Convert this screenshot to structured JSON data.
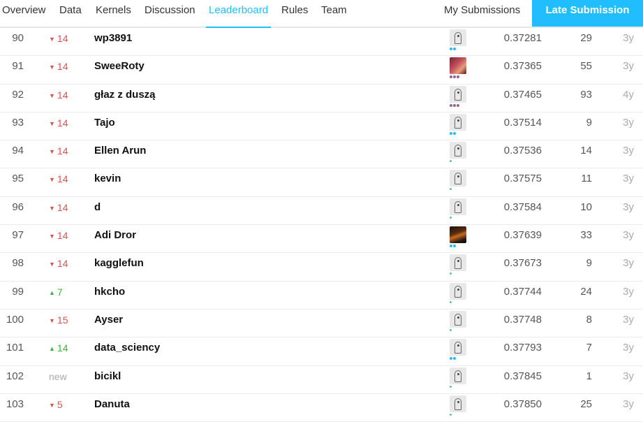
{
  "nav": {
    "tabs": [
      {
        "label": "Overview",
        "name": "tab-overview",
        "active": false
      },
      {
        "label": "Data",
        "name": "tab-data",
        "active": false
      },
      {
        "label": "Kernels",
        "name": "tab-kernels",
        "active": false
      },
      {
        "label": "Discussion",
        "name": "tab-discussion",
        "active": false
      },
      {
        "label": "Leaderboard",
        "name": "tab-leaderboard",
        "active": true
      },
      {
        "label": "Rules",
        "name": "tab-rules",
        "active": false
      },
      {
        "label": "Team",
        "name": "tab-team",
        "active": false
      }
    ],
    "my_submissions": "My Submissions",
    "late_submission": "Late Submission"
  },
  "colors": {
    "accent": "#20beff",
    "down": "#d9534f",
    "up": "#3db33d",
    "tier_contributor": "#20beff",
    "tier_expert": "#95628f",
    "tier_novice": "#5ac995"
  },
  "leaderboard": {
    "rows": [
      {
        "rank": "90",
        "change": "14",
        "direction": "down",
        "team": "wp3891",
        "avatar": "default",
        "tier": "contributor",
        "score": "0.37281",
        "entries": "29",
        "last": "3y"
      },
      {
        "rank": "91",
        "change": "14",
        "direction": "down",
        "team": "SweeRoty",
        "avatar": "photo1",
        "tier": "expert",
        "score": "0.37365",
        "entries": "55",
        "last": "3y"
      },
      {
        "rank": "92",
        "change": "14",
        "direction": "down",
        "team": "głaz z duszą",
        "avatar": "default",
        "tier": "expert",
        "score": "0.37465",
        "entries": "93",
        "last": "4y"
      },
      {
        "rank": "93",
        "change": "14",
        "direction": "down",
        "team": "Tajo",
        "avatar": "default",
        "tier": "contributor",
        "score": "0.37514",
        "entries": "9",
        "last": "3y"
      },
      {
        "rank": "94",
        "change": "14",
        "direction": "down",
        "team": "Ellen Arun",
        "avatar": "default",
        "tier": "novice",
        "score": "0.37536",
        "entries": "14",
        "last": "3y"
      },
      {
        "rank": "95",
        "change": "14",
        "direction": "down",
        "team": "kevin",
        "avatar": "default",
        "tier": "novice",
        "score": "0.37575",
        "entries": "11",
        "last": "3y"
      },
      {
        "rank": "96",
        "change": "14",
        "direction": "down",
        "team": "d",
        "avatar": "default",
        "tier": "novice",
        "score": "0.37584",
        "entries": "10",
        "last": "3y"
      },
      {
        "rank": "97",
        "change": "14",
        "direction": "down",
        "team": "Adi Dror",
        "avatar": "photo2",
        "tier": "contributor",
        "score": "0.37639",
        "entries": "33",
        "last": "3y"
      },
      {
        "rank": "98",
        "change": "14",
        "direction": "down",
        "team": "kagglefun",
        "avatar": "default",
        "tier": "novice",
        "score": "0.37673",
        "entries": "9",
        "last": "3y"
      },
      {
        "rank": "99",
        "change": "7",
        "direction": "up",
        "team": "hkcho",
        "avatar": "default",
        "tier": "novice",
        "score": "0.37744",
        "entries": "24",
        "last": "3y"
      },
      {
        "rank": "100",
        "change": "15",
        "direction": "down",
        "team": "Ayser",
        "avatar": "default",
        "tier": "novice",
        "score": "0.37748",
        "entries": "8",
        "last": "3y"
      },
      {
        "rank": "101",
        "change": "14",
        "direction": "up",
        "team": "data_sciency",
        "avatar": "default",
        "tier": "contributor",
        "score": "0.37793",
        "entries": "7",
        "last": "3y"
      },
      {
        "rank": "102",
        "change": "new",
        "direction": "new",
        "team": "bicikl",
        "avatar": "default",
        "tier": "novice",
        "score": "0.37845",
        "entries": "1",
        "last": "3y"
      },
      {
        "rank": "103",
        "change": "5",
        "direction": "down",
        "team": "Danuta",
        "avatar": "default",
        "tier": "novice",
        "score": "0.37850",
        "entries": "25",
        "last": "3y"
      }
    ]
  }
}
